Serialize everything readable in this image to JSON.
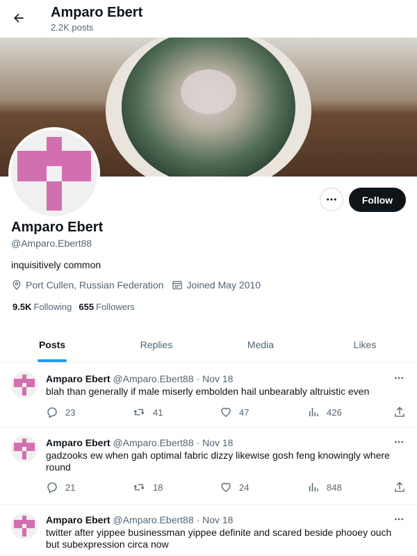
{
  "header": {
    "title": "Amparo Ebert",
    "post_count": "2.2K posts"
  },
  "profile": {
    "name": "Amparo Ebert",
    "handle": "@Amparo.Ebert88",
    "bio": "inquisitively common",
    "location": "Port Cullen, Russian Federation",
    "joined": "Joined May 2010",
    "following_count": "9.5K",
    "following_label": "Following",
    "followers_count": "655",
    "followers_label": "Followers",
    "follow_label": "Follow"
  },
  "tabs": [
    {
      "label": "Posts",
      "active": true
    },
    {
      "label": "Replies",
      "active": false
    },
    {
      "label": "Media",
      "active": false
    },
    {
      "label": "Likes",
      "active": false
    }
  ],
  "posts": [
    {
      "name": "Amparo Ebert",
      "handle": "@Amparo.Ebert88",
      "date": "Nov 18",
      "text": "blah than generally if male miserly embolden hail unbearably altruistic even",
      "replies": "23",
      "reposts": "41",
      "likes": "47",
      "views": "426"
    },
    {
      "name": "Amparo Ebert",
      "handle": "@Amparo.Ebert88",
      "date": "Nov 18",
      "text": "gadzooks ew when gah optimal fabric dizzy likewise gosh feng knowingly where round",
      "replies": "21",
      "reposts": "18",
      "likes": "24",
      "views": "848"
    },
    {
      "name": "Amparo Ebert",
      "handle": "@Amparo.Ebert88",
      "date": "Nov 18",
      "text": "twitter after yippee businessman yippee definite and scared beside phooey ouch but subexpression circa now",
      "replies": "",
      "reposts": "",
      "likes": "",
      "views": ""
    }
  ],
  "colors": {
    "accent": "#1d9bf0",
    "avatar_pink": "#d26fb0",
    "follow_bg": "#0f1419"
  },
  "icons": [
    "back-arrow-icon",
    "more-icon",
    "location-icon",
    "calendar-icon",
    "reply-icon",
    "repost-icon",
    "like-icon",
    "views-icon",
    "share-icon"
  ]
}
